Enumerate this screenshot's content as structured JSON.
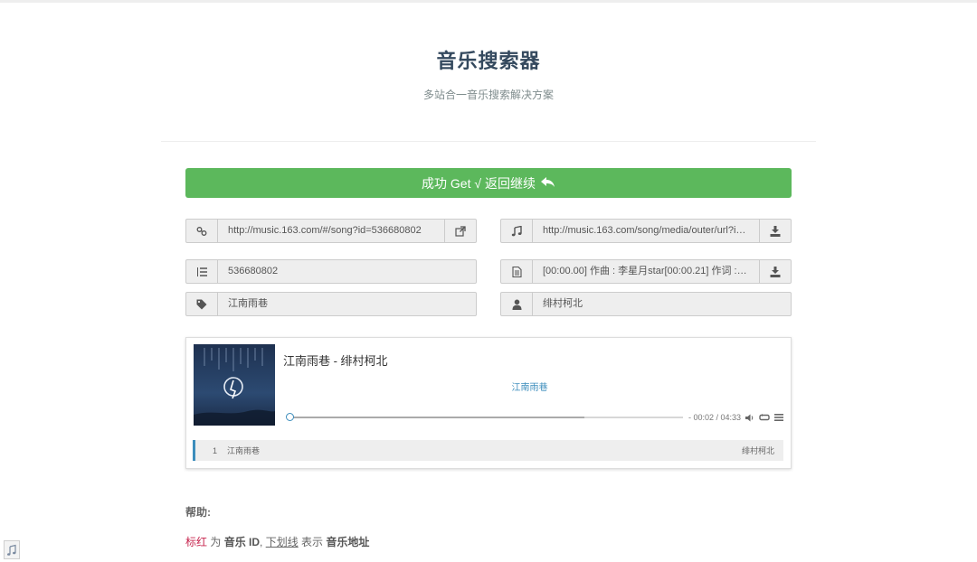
{
  "header": {
    "title": "音乐搜索器",
    "subtitle": "多站合一音乐搜索解决方案"
  },
  "success_button": {
    "label": "成功 Get √ 返回继续",
    "icon": "reply-icon",
    "color": "#5cb85c"
  },
  "fields": {
    "song_link": {
      "icon": "link-icon",
      "value": "http://music.163.com/#/song?id=536680802",
      "action_icon": "external-link-icon"
    },
    "music_url": {
      "icon": "music-note-icon",
      "value": "http://music.163.com/song/media/outer/url?id=...",
      "action_icon": "download-icon"
    },
    "song_id": {
      "icon": "list-ordered-icon",
      "value": "536680802"
    },
    "lyrics": {
      "icon": "file-text-icon",
      "value": "[00:00.00] 作曲 : 李星月star[00:00.21] 作词 : 李星...",
      "action_icon": "download-icon"
    },
    "song_name": {
      "icon": "tag-icon",
      "value": "江南雨巷"
    },
    "artist": {
      "icon": "user-icon",
      "value": "绯村柯北"
    }
  },
  "player": {
    "title": "江南雨巷 - 绯村柯北",
    "lyric_line": "江南雨巷",
    "time": "- 00:02 / 04:33",
    "progress": 0.007,
    "loaded": 0.75,
    "accent": "#3c8dbc",
    "playlist": [
      {
        "index": "1",
        "name": "江南雨巷",
        "artist": "绯村柯北"
      }
    ]
  },
  "help": {
    "title": "帮助:",
    "red_text": "标红",
    "text_1": " 为 ",
    "bold_1": "音乐 ID",
    "text_2": ", ",
    "underline_text": "下划线",
    "text_3": " 表示 ",
    "bold_2": "音乐地址"
  }
}
